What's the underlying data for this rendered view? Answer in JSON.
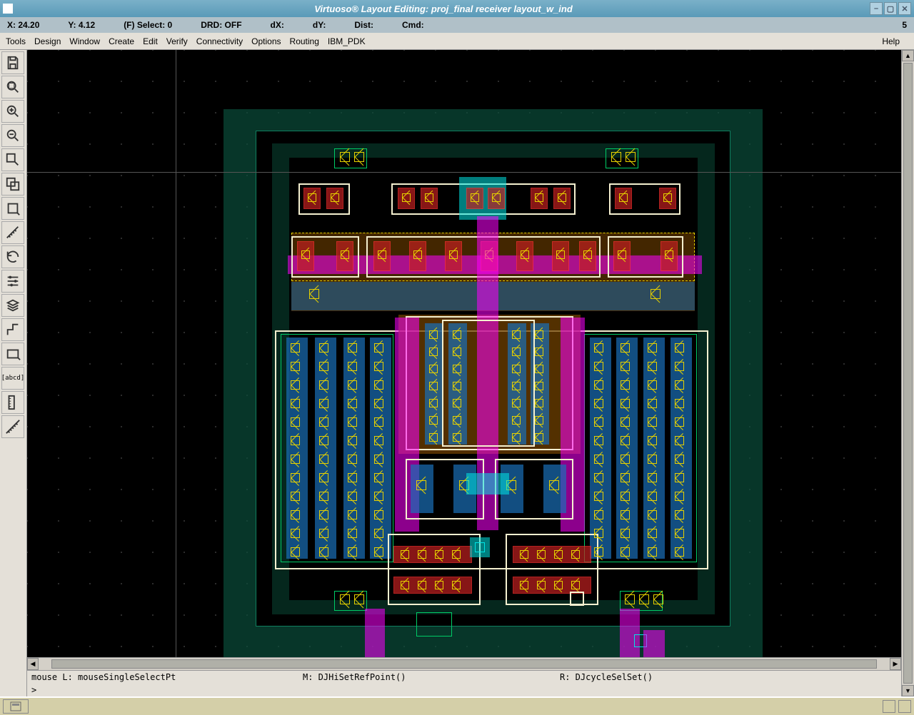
{
  "titlebar": {
    "title": "Virtuoso® Layout Editing: proj_final receiver layout_w_ind"
  },
  "status": {
    "x_label": "X:",
    "x_val": "24.20",
    "y_label": "Y:",
    "y_val": "4.12",
    "select": "(F) Select: 0",
    "drd": "DRD: OFF",
    "dx": "dX:",
    "dy": "dY:",
    "dist": "Dist:",
    "cmd": "Cmd:",
    "right": "5"
  },
  "menu": [
    "Tools",
    "Design",
    "Window",
    "Create",
    "Edit",
    "Verify",
    "Connectivity",
    "Options",
    "Routing",
    "IBM_PDK"
  ],
  "menu_help": "Help",
  "tool_icons": [
    "save",
    "zoom-fit",
    "zoom-in",
    "zoom-out",
    "stretch",
    "copy",
    "move",
    "ruler",
    "undo",
    "props",
    "flatten",
    "path",
    "rect",
    "label",
    "ruler2",
    "measure"
  ],
  "mouse": {
    "L": "mouse L: mouseSingleSelectPt",
    "M": "M: DJHiSetRefPoint()",
    "R": "R: DJcycleSelSet()"
  },
  "prompt": ">",
  "winbtns": {
    "min": "–",
    "max": "▢",
    "close": "✕"
  },
  "colors": {
    "nwell": "#0a4d3a",
    "metal1": "#1a6fb8",
    "metal2": "#00e5e5",
    "metal3": "#ff00ff",
    "poly": "#c02020",
    "contact": "#e5d000",
    "select_box": "#f5f0d0"
  }
}
